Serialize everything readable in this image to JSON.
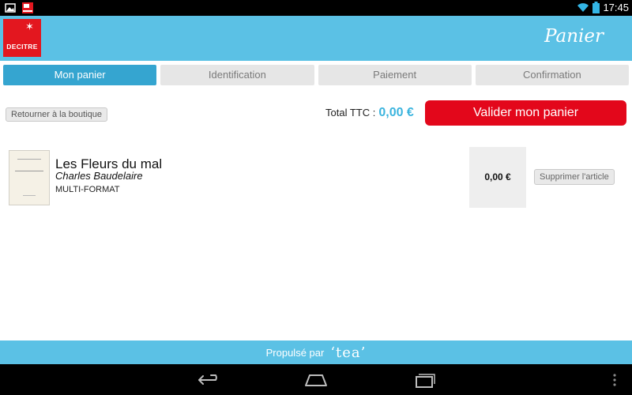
{
  "status_bar": {
    "time": "17:45",
    "left_icons": [
      "image-icon",
      "decitre-app-icon"
    ],
    "right_icons": [
      "wifi-icon",
      "battery-icon"
    ]
  },
  "app_bar": {
    "logo_text": "DECITRE",
    "title": "Panier"
  },
  "steps": [
    {
      "label": "Mon panier",
      "active": true
    },
    {
      "label": "Identification",
      "active": false
    },
    {
      "label": "Paiement",
      "active": false
    },
    {
      "label": "Confirmation",
      "active": false
    }
  ],
  "cart": {
    "back_label": "Retourner à la boutique",
    "total_label": "Total TTC :",
    "total_value": "0,00 €",
    "validate_label": "Valider mon panier"
  },
  "items": [
    {
      "title": "Les Fleurs du mal",
      "author": "Charles Baudelaire",
      "format": "MULTI-FORMAT",
      "price": "0,00 €",
      "remove_label": "Supprimer l'article"
    }
  ],
  "footer": {
    "powered_by": "Propulsé par",
    "brand": "‘tea’"
  },
  "nav_bar": {
    "buttons": [
      "back-icon",
      "home-icon",
      "recent-apps-icon",
      "overflow-menu-icon"
    ]
  },
  "colors": {
    "accent": "#5bc1e5",
    "active_step": "#35a5d0",
    "validate": "#e3071b",
    "total": "#3bb4de",
    "logo": "#e3171f"
  }
}
